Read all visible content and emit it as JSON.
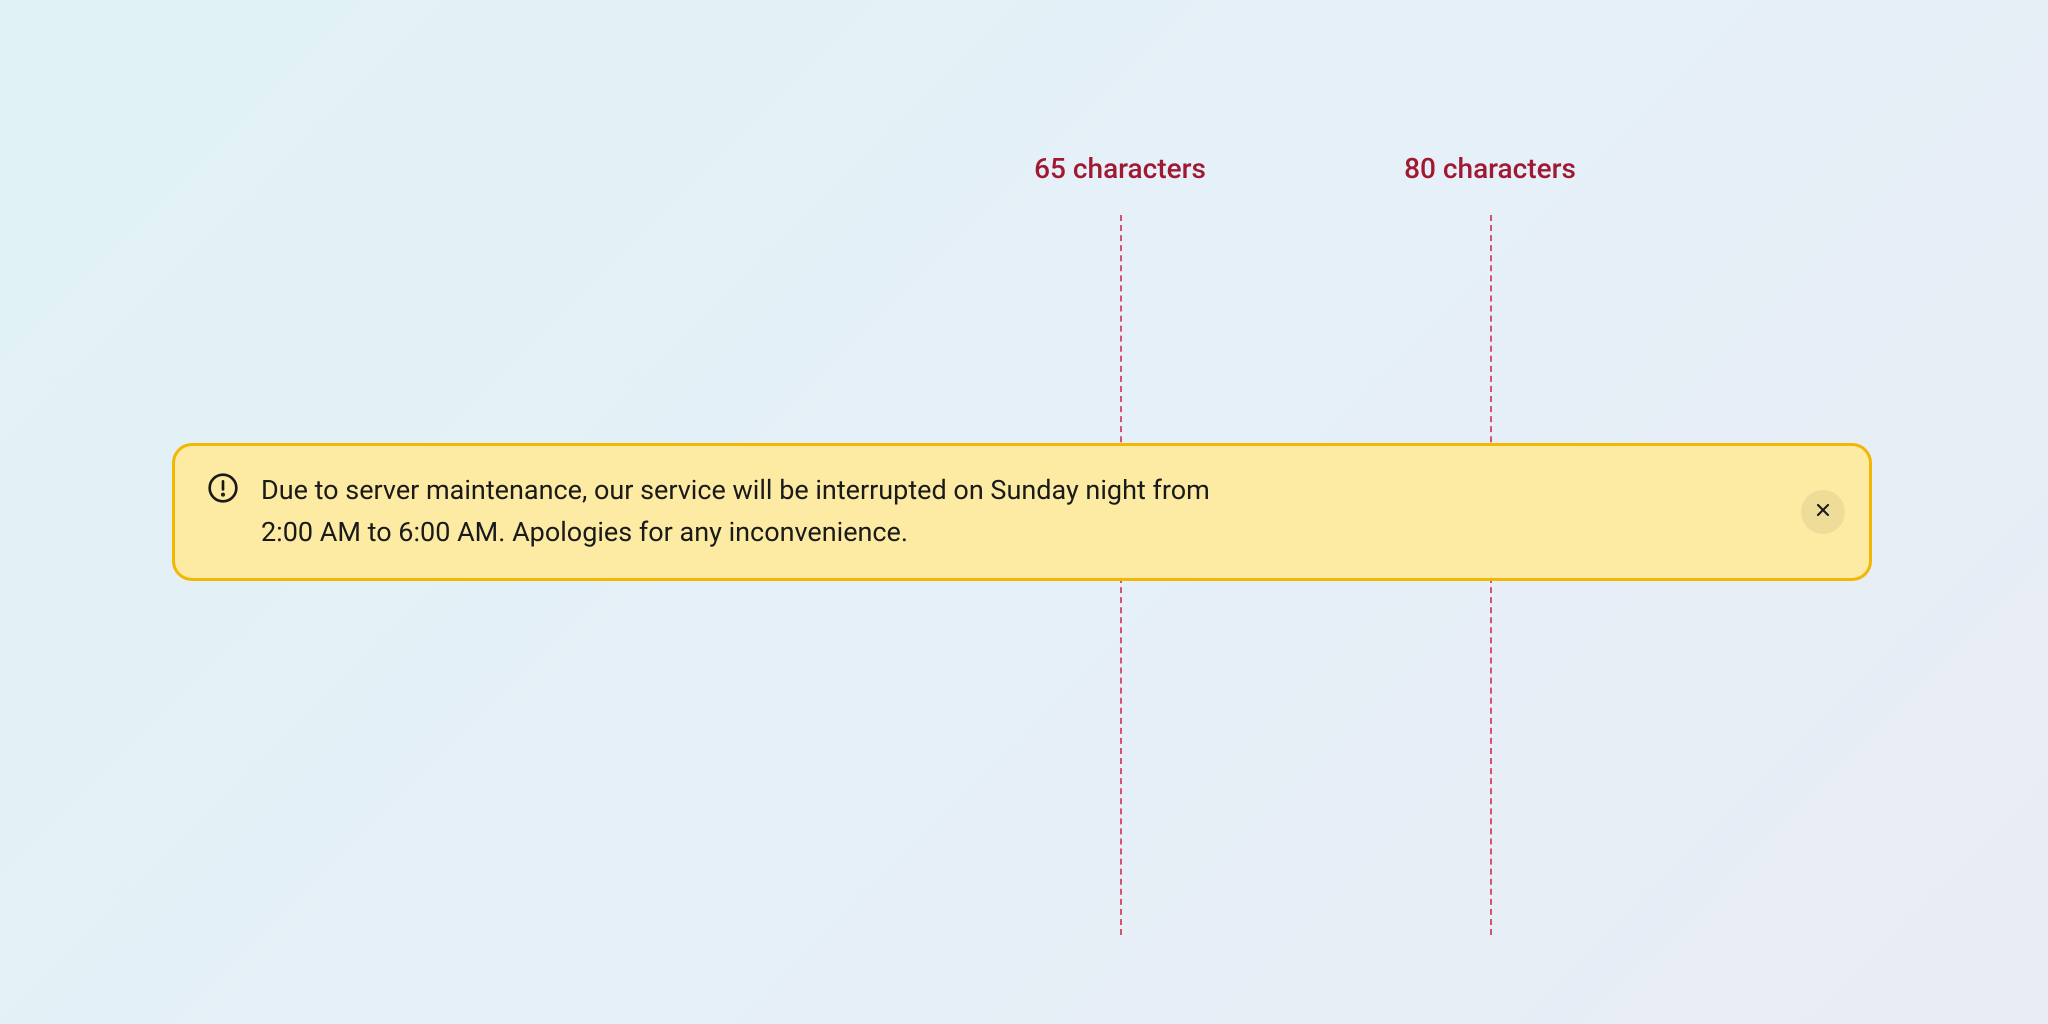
{
  "markers": {
    "label65": "65 characters",
    "label80": "80 characters"
  },
  "banner": {
    "message": "Due to server maintenance, our service will be interrupted on Sunday night from 2:00 AM to 6:00 AM. Apologies for any inconvenience.",
    "iconName": "alert-circle-icon",
    "closeIconName": "close-icon"
  },
  "colors": {
    "markerText": "#a01832",
    "markerLine": "#d4536f",
    "bannerBg": "#fdeba3",
    "bannerBorder": "#f2b705",
    "bannerText": "#1a1a1a"
  }
}
